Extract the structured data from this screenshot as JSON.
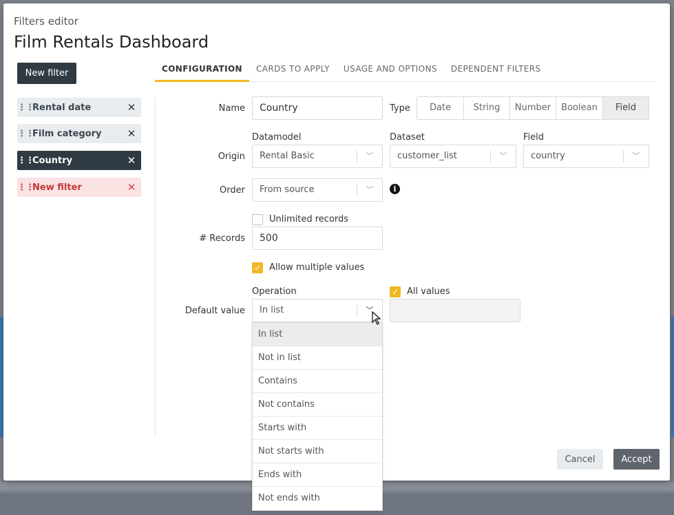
{
  "modal": {
    "subtitle": "Filters editor",
    "title": "Film Rentals Dashboard"
  },
  "sidebar": {
    "new_filter_label": "New filter",
    "items": [
      {
        "label": "Rental date",
        "state": "normal"
      },
      {
        "label": "Film category",
        "state": "normal"
      },
      {
        "label": "Country",
        "state": "active"
      },
      {
        "label": "New filter",
        "state": "new"
      }
    ]
  },
  "tabs": [
    {
      "label": "CONFIGURATION",
      "active": true
    },
    {
      "label": "CARDS TO APPLY",
      "active": false
    },
    {
      "label": "USAGE AND OPTIONS",
      "active": false
    },
    {
      "label": "DEPENDENT FILTERS",
      "active": false
    }
  ],
  "form": {
    "name_label": "Name",
    "name_value": "Country",
    "type_label": "Type",
    "type_options": [
      "Date",
      "String",
      "Number",
      "Boolean",
      "Field"
    ],
    "type_selected": "Field",
    "origin_label": "Origin",
    "datamodel_label": "Datamodel",
    "datamodel_value": "Rental Basic",
    "dataset_label": "Dataset",
    "dataset_value": "customer_list",
    "field_label": "Field",
    "field_value": "country",
    "order_label": "Order",
    "order_value": "From source",
    "unlimited_label": "Unlimited records",
    "unlimited_checked": false,
    "records_label": "# Records",
    "records_value": "500",
    "allow_multiple_label": "Allow multiple values",
    "allow_multiple_checked": true,
    "operation_label": "Operation",
    "all_values_label": "All values",
    "all_values_checked": true,
    "default_value_label": "Default value",
    "operation_value": "In list",
    "operation_options": [
      "In list",
      "Not in list",
      "Contains",
      "Not contains",
      "Starts with",
      "Not starts with",
      "Ends with",
      "Not ends with"
    ]
  },
  "footer": {
    "cancel_label": "Cancel",
    "accept_label": "Accept"
  },
  "colors": {
    "accent": "#f0b823",
    "dark": "#2f3a42",
    "danger": "#c0393b"
  }
}
